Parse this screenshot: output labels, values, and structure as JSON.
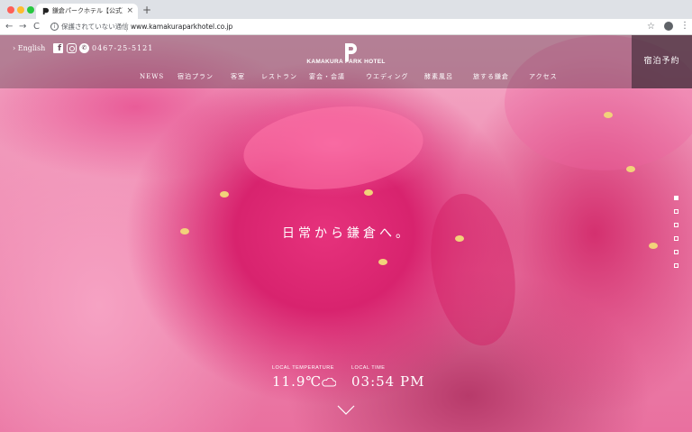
{
  "browser": {
    "tab_title": "鎌倉パークホテル【公式】| KA",
    "tab_close": "×",
    "new_tab": "+",
    "back": "←",
    "forward": "→",
    "reload": "C",
    "info": "i",
    "security_text": "保護されていない通信",
    "url": "www.kamakuraparkhotel.co.jp",
    "star": "☆",
    "menu": "⋮"
  },
  "header": {
    "lang_link": "› English",
    "facebook": "f",
    "phone_glyph": "✆",
    "phone": "0467-25-5121",
    "logo_text": "KAMAKURA PARK HOTEL",
    "reserve": "宿泊予約",
    "nav": [
      "NEWS",
      "宿泊プラン",
      "客室",
      "レストラン",
      "宴会・会議",
      "ウエディング",
      "酵素風呂",
      "旅する鎌倉",
      "アクセス"
    ]
  },
  "hero": {
    "copy": "日常から鎌倉へ。",
    "slides": {
      "count": 6,
      "active": 0
    }
  },
  "weather": {
    "temp_label": "LOCAL TEMPERATURE",
    "temp_value": "11.9℃",
    "time_label": "LOCAL TIME",
    "time_value": "03:54 PM"
  },
  "colors": {
    "reserve_bg": "#462d3c",
    "hero_pink": "#e6327c",
    "stamen": "#f2d27a"
  }
}
